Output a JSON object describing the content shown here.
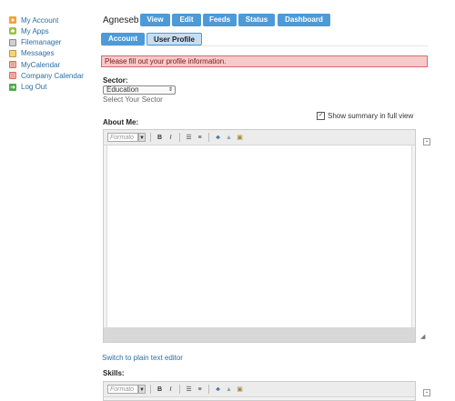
{
  "sidebar": {
    "items": [
      {
        "label": "My Account",
        "icon": "account-icon"
      },
      {
        "label": "My Apps",
        "icon": "apps-icon"
      },
      {
        "label": "Filemanager",
        "icon": "file-icon"
      },
      {
        "label": "Messages",
        "icon": "message-icon"
      },
      {
        "label": "MyCalendar",
        "icon": "calendar-icon"
      },
      {
        "label": "Company Calendar",
        "icon": "calendar-icon"
      },
      {
        "label": "Log Out",
        "icon": "logout-icon"
      }
    ]
  },
  "header": {
    "user": "Agneseb",
    "tabs": [
      "View",
      "Edit",
      "Feeds",
      "Status",
      "Dashboard"
    ],
    "subtabs": [
      "Account",
      "User Profile"
    ]
  },
  "alert": "Please fill out your profile information.",
  "sector": {
    "label": "Sector:",
    "value": "Education",
    "hint": "Select Your Sector"
  },
  "about": {
    "label": "About Me:",
    "summary_label": "Show summary in full view",
    "format_placeholder": "Formato",
    "switch_link": "Switch to plain text editor"
  },
  "skills": {
    "label": "Skills:",
    "format_placeholder": "Formato"
  },
  "colors": {
    "accent": "#4d9ad8",
    "alert_bg": "#f8c9c9",
    "link": "#2a6ea6"
  }
}
